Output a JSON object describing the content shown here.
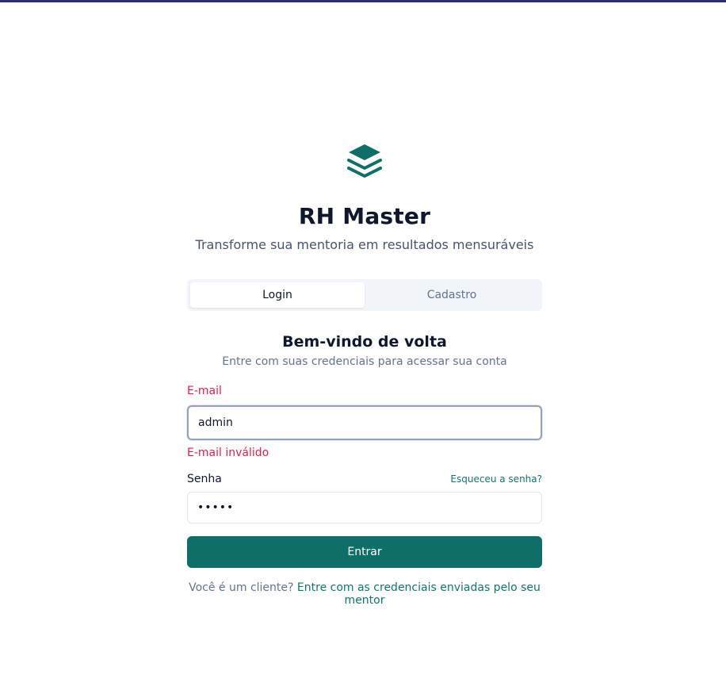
{
  "app": {
    "title": "RH Master",
    "tagline": "Transforme sua mentoria em resultados mensuráveis",
    "logo_icon": "layers-icon",
    "accent_color": "#0f6e68",
    "error_color": "#e11d48"
  },
  "tabs": [
    {
      "label": "Login",
      "active": true
    },
    {
      "label": "Cadastro",
      "active": false
    }
  ],
  "form": {
    "heading": "Bem-vindo de volta",
    "subheading": "Entre com suas credenciais para acessar sua conta",
    "email_label": "E-mail",
    "email_value": "admin",
    "email_error": "E-mail inválido",
    "password_label": "Senha",
    "password_value": "admin",
    "forgot_label": "Esqueceu a senha?",
    "submit_label": "Entrar"
  },
  "footer": {
    "prefix": "Você é um cliente?",
    "link": "Entre com as credenciais enviadas pelo seu mentor"
  }
}
